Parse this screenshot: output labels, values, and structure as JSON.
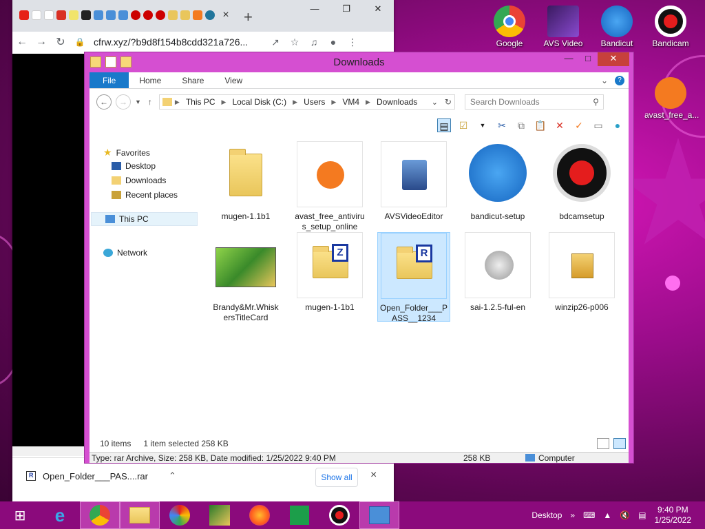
{
  "desktop": {
    "icons": [
      {
        "label": "Google",
        "icon": "chrome-icon"
      },
      {
        "label": "AVS Video",
        "icon": "avs-video-icon"
      },
      {
        "label": "Bandicut",
        "icon": "bandicut-icon"
      },
      {
        "label": "Bandicam",
        "icon": "bandicam-icon"
      },
      {
        "label": "avast_free_a...",
        "icon": "avast-icon"
      }
    ]
  },
  "browser": {
    "url": "cfrw.xyz/?b9d8f154b8cdd321a726...",
    "tab_close": "×",
    "new_tab": "+",
    "download": {
      "filename": "Open_Folder___PAS....rar",
      "show_all": "Show all",
      "close": "×"
    }
  },
  "explorer": {
    "title": "Downloads",
    "ribbon_tabs": [
      "File",
      "Home",
      "Share",
      "View"
    ],
    "breadcrumb": [
      "This PC",
      "Local Disk (C:)",
      "Users",
      "VM4",
      "Downloads"
    ],
    "search_placeholder": "Search Downloads",
    "nav": {
      "favorites": "Favorites",
      "desktop": "Desktop",
      "downloads": "Downloads",
      "recent": "Recent places",
      "thispc": "This PC",
      "network": "Network"
    },
    "files": [
      {
        "name": "mugen-1.1b1",
        "type": "folder"
      },
      {
        "name": "avast_free_antivirus_setup_online",
        "type": "exe"
      },
      {
        "name": "AVSVideoEditor",
        "type": "exe"
      },
      {
        "name": "bandicut-setup",
        "type": "exe"
      },
      {
        "name": "bdcamsetup",
        "type": "exe"
      },
      {
        "name": "Brandy&Mr.WhiskersTitleCard",
        "type": "image"
      },
      {
        "name": "mugen-1-1b1",
        "type": "zip"
      },
      {
        "name": "Open_Folder___PASS__1234",
        "type": "rar",
        "selected": true
      },
      {
        "name": "sai-1.2.5-ful-en",
        "type": "exe"
      },
      {
        "name": "winzip26-p006",
        "type": "exe"
      }
    ],
    "footer": {
      "count": "10 items",
      "selection": "1 item selected  258 KB"
    },
    "status": {
      "details": "Type: rar Archive, Size: 258 KB, Date modified: 1/25/2022 9:40 PM",
      "size": "258 KB",
      "location": "Computer"
    }
  },
  "taskbar": {
    "desktop_label": "Desktop",
    "time": "9:40 PM",
    "date": "1/25/2022"
  },
  "colors": {
    "desktop_bg": "#9a0c8a",
    "explorer_frame": "#d54fd1",
    "taskbar": "#8b0a7c",
    "file_tab": "#1979ca",
    "selection": "#cce8ff"
  }
}
